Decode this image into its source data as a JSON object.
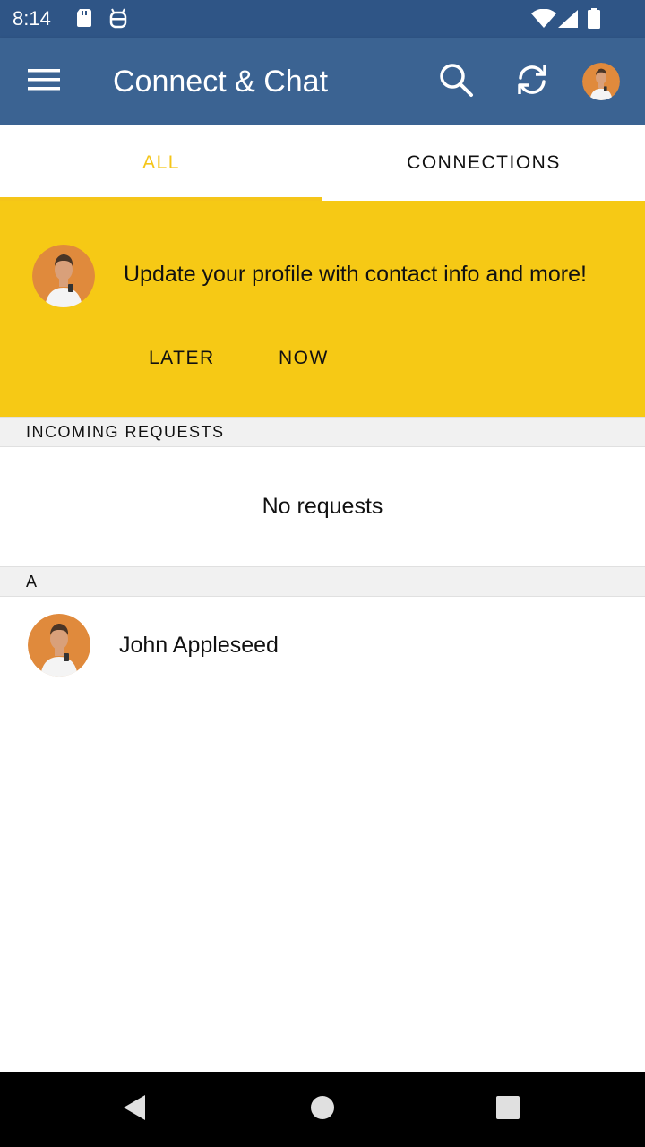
{
  "status_bar": {
    "time": "8:14",
    "left_icons": [
      "sd-card-icon",
      "android-debug-icon"
    ],
    "right_icons": [
      "wifi-icon",
      "signal-icon",
      "battery-icon"
    ]
  },
  "app_bar": {
    "title": "Connect & Chat",
    "color": "#3b6392",
    "icons": [
      "menu-icon",
      "search-icon",
      "refresh-icon",
      "profile-avatar"
    ]
  },
  "tabs": [
    {
      "label": "ALL",
      "selected": true
    },
    {
      "label": "CONNECTIONS",
      "selected": false
    }
  ],
  "accent_color": "#f5c518",
  "profile_banner": {
    "message": "Update your profile with contact info and more!",
    "later_label": "LATER",
    "now_label": "NOW",
    "color": "#f6c915"
  },
  "incoming_requests": {
    "header": "INCOMING REQUESTS",
    "empty_text": "No requests"
  },
  "contacts_section": {
    "header": "A",
    "contacts": [
      {
        "name": "John Appleseed"
      }
    ]
  },
  "nav_bar": {
    "icons": [
      "back-icon",
      "home-icon",
      "recents-icon"
    ]
  }
}
